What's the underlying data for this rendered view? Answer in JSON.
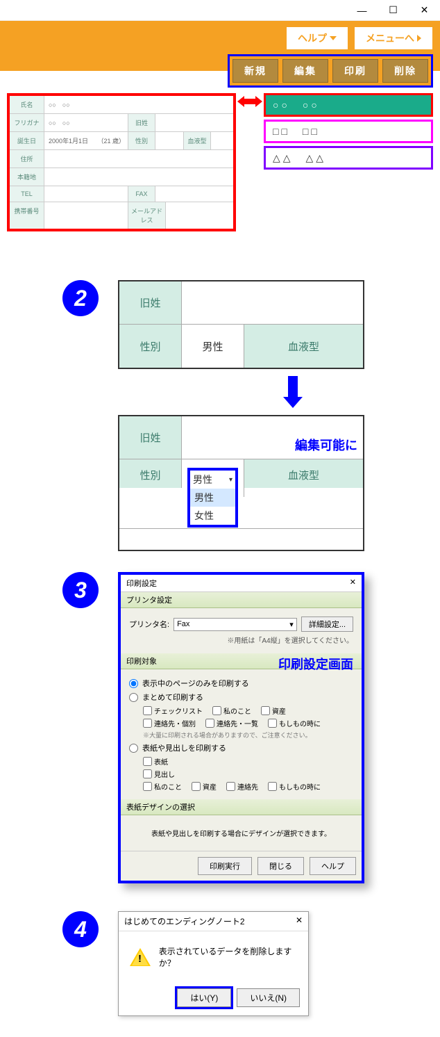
{
  "chrome": {
    "min": "—",
    "max": "☐",
    "close": "✕"
  },
  "header": {
    "help": "ヘルプ",
    "menu": "メニューへ"
  },
  "toolbar": {
    "new": "新規",
    "edit": "編集",
    "print": "印刷",
    "delete": "削除"
  },
  "form": {
    "labels": {
      "name": "氏名",
      "furigana": "フリガナ",
      "birthday": "誕生日",
      "oldname": "旧姓",
      "gender": "性別",
      "blood": "血液型",
      "address": "住所",
      "honseki": "本籍地",
      "tel": "TEL",
      "fax": "FAX",
      "mobile": "携帯番号",
      "mail": "メールアドレス"
    },
    "values": {
      "name": "○○　○○",
      "furigana": "○○　○○",
      "birthday": "2000年1月1日　　（21 歳）"
    }
  },
  "namelist": {
    "r1": "○○　○○",
    "r2": "□□　□□",
    "r3": "△△　△△"
  },
  "step2": {
    "oldname": "旧姓",
    "gender": "性別",
    "blood": "血液型",
    "male": "男性",
    "female": "女性",
    "editable": "編集可能に"
  },
  "step3": {
    "title": "印刷設定",
    "printer_section": "プリンタ設定",
    "printer_label": "プリンタ名:",
    "printer_value": "Fax",
    "detail_btn": "詳細設定...",
    "paper_note": "※用紙は「A4縦」を選択してください。",
    "target_section": "印刷対象",
    "radio1": "表示中のページのみを印刷する",
    "radio2": "まとめて印刷する",
    "check_list": [
      "チェックリスト",
      "私のこと",
      "資産",
      "連絡先・個別",
      "連絡先・一覧",
      "もしもの時に"
    ],
    "mass_note": "※大量に印刷される場合がありますので、ご注意ください。",
    "radio3": "表紙や見出しを印刷する",
    "check_list2": [
      "表紙",
      "見出し",
      "私のこと",
      "資産",
      "連絡先",
      "もしもの時に"
    ],
    "design_section": "表紙デザインの選択",
    "design_note": "表紙や見出しを印刷する場合にデザインが選択できます。",
    "big_label": "印刷設定画面",
    "btn_exec": "印刷実行",
    "btn_close": "閉じる",
    "btn_help": "ヘルプ"
  },
  "step4": {
    "title": "はじめてのエンディングノート2",
    "msg": "表示されているデータを削除しますか？",
    "yes": "はい(Y)",
    "no": "いいえ(N)"
  },
  "badges": {
    "b2": "2",
    "b3": "3",
    "b4": "4"
  }
}
